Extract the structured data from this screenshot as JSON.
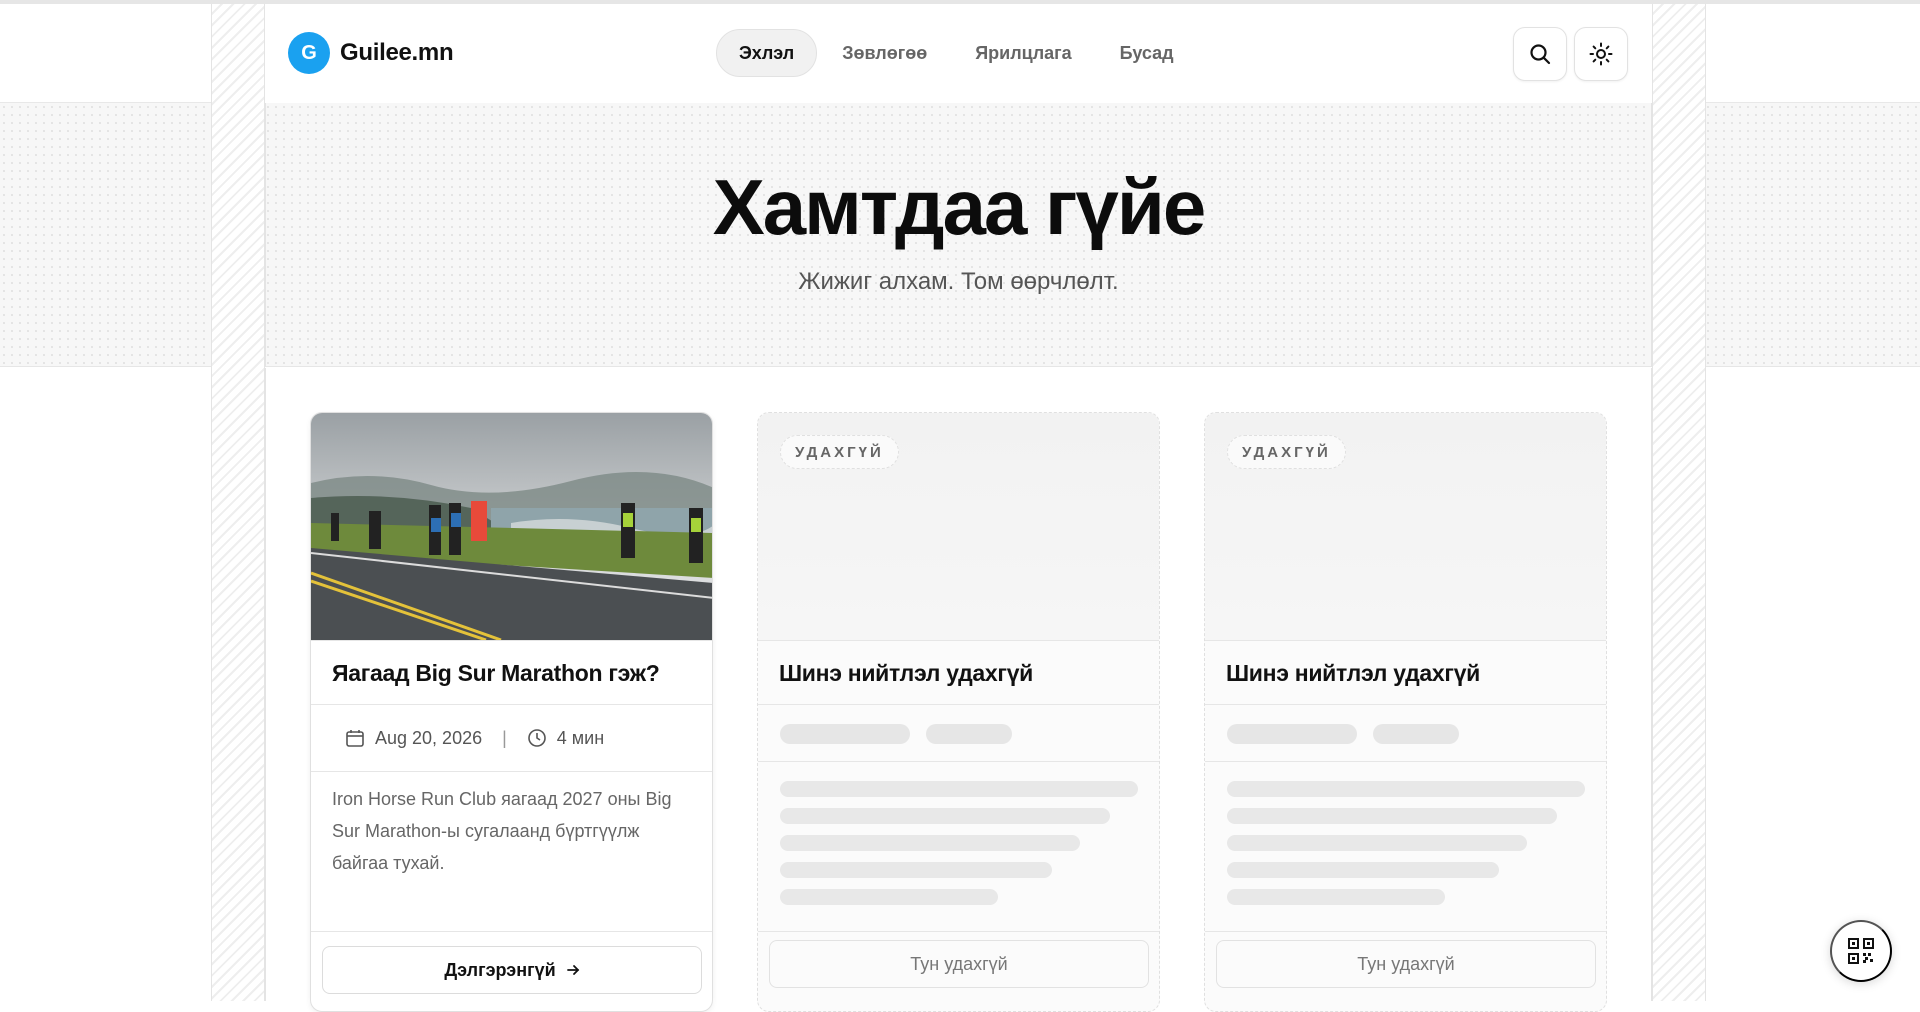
{
  "header": {
    "logo_letter": "G",
    "site_name": "Guilee.mn",
    "nav": [
      {
        "label": "Эхлэл",
        "active": true
      },
      {
        "label": "Зөвлөгөө",
        "active": false
      },
      {
        "label": "Ярилцлага",
        "active": false
      },
      {
        "label": "Бусад",
        "active": false
      }
    ],
    "search_icon": "search-icon",
    "theme_icon": "sun-icon"
  },
  "hero": {
    "title": "Хамтдаа гүйе",
    "subtitle": "Жижиг алхам. Том өөрчлөлт."
  },
  "cards": [
    {
      "title": "Яагаад Big Sur Marathon гэж?",
      "date": "Aug 20, 2026",
      "read_time": "4 мин",
      "excerpt": "Iron Horse Run Club яагаад 2027 оны Big Sur Marathon-ы сугалаанд бүртгүүлж байгаа тухай.",
      "button": "Дэлгэрэнгүй",
      "image": "marathon-runners-coastal-road-photo"
    },
    {
      "badge": "УДАХГҮЙ",
      "title": "Шинэ нийтлэл удахгүй",
      "button": "Тун удахгүй"
    },
    {
      "badge": "УДАХГҮЙ",
      "title": "Шинэ нийтлэл удахгүй",
      "button": "Тун удахгүй"
    }
  ],
  "colors": {
    "brand": "#1aa1f0",
    "text": "#111111",
    "muted": "#666666"
  },
  "floating": {
    "qr_icon": "qr-code-icon"
  }
}
